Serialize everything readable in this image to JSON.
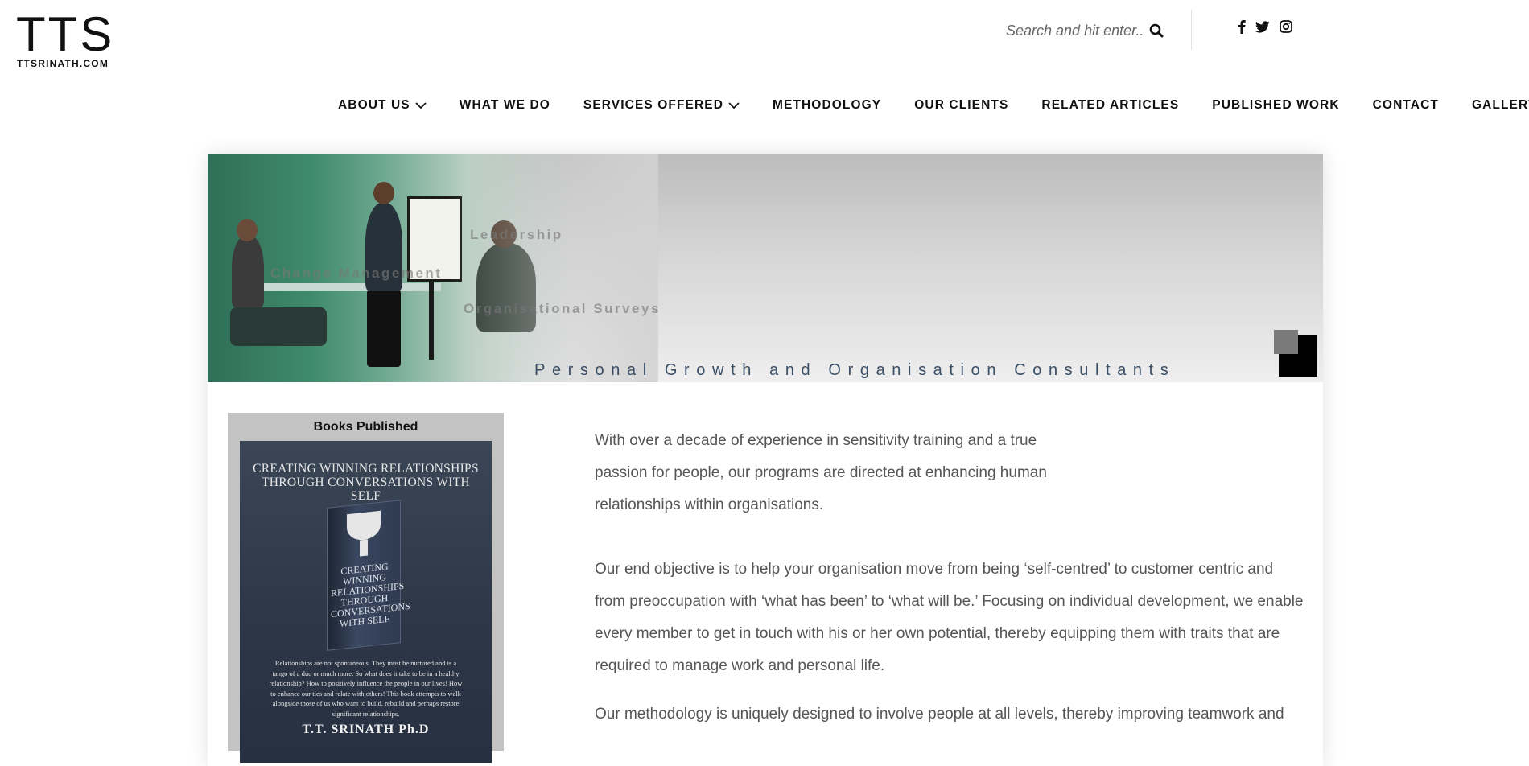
{
  "logo": {
    "mark": "TTS",
    "site": "TTSRINATH.COM"
  },
  "search": {
    "placeholder": "Search and hit enter.."
  },
  "social": [
    "facebook-icon",
    "twitter-icon",
    "instagram-icon"
  ],
  "nav": {
    "about": "ABOUT US",
    "what_we_do": "WHAT WE DO",
    "services": "SERVICES OFFERED",
    "methodology": "METHODOLOGY",
    "clients": "OUR CLIENTS",
    "articles": "RELATED ARTICLES",
    "published": "PUBLISHED WORK",
    "contact": "CONTACT",
    "gallery": "GALLERY"
  },
  "banner": {
    "word_1": "Leadership",
    "word_2": "Change Management",
    "word_3": "Organisational Surveys",
    "tagline": "Personal Growth and Organisation Consultants"
  },
  "book": {
    "box_title": "Books Published",
    "cover_heading": "Creating Winning Relationships Through Conversations With Self",
    "cover_book_text": "CREATING WINNING RELATIONSHIPS THROUGH CONVERSATIONS WITH SELF",
    "blurb": "Relationships are not spontaneous. They must be nurtured and is a tango of a duo or much more. So what does it take to be in a healthy relationship? How to positively influence the people in our lives! How to enhance our ties and relate with others! This book attempts to walk alongside those of us who want to build, rebuild and perhaps restore significant relationships.",
    "author": "T.T. SRINATH Ph.D"
  },
  "content": {
    "intro": "With over a decade of experience in sensitivity training and a true passion for people, our programs are directed at enhancing human relationships within organisations.",
    "objective": "Our end objective is to help your organisation move from being ‘self-centred’ to customer centric and from preoccupation with ‘what has been’ to ‘what will be.’ Focusing on individual development, we enable every member to get in touch with his or her own potential, thereby equipping them with traits that are required to manage work and personal life.",
    "methodology": "Our methodology is uniquely designed to involve people at all levels, thereby improving teamwork and"
  }
}
